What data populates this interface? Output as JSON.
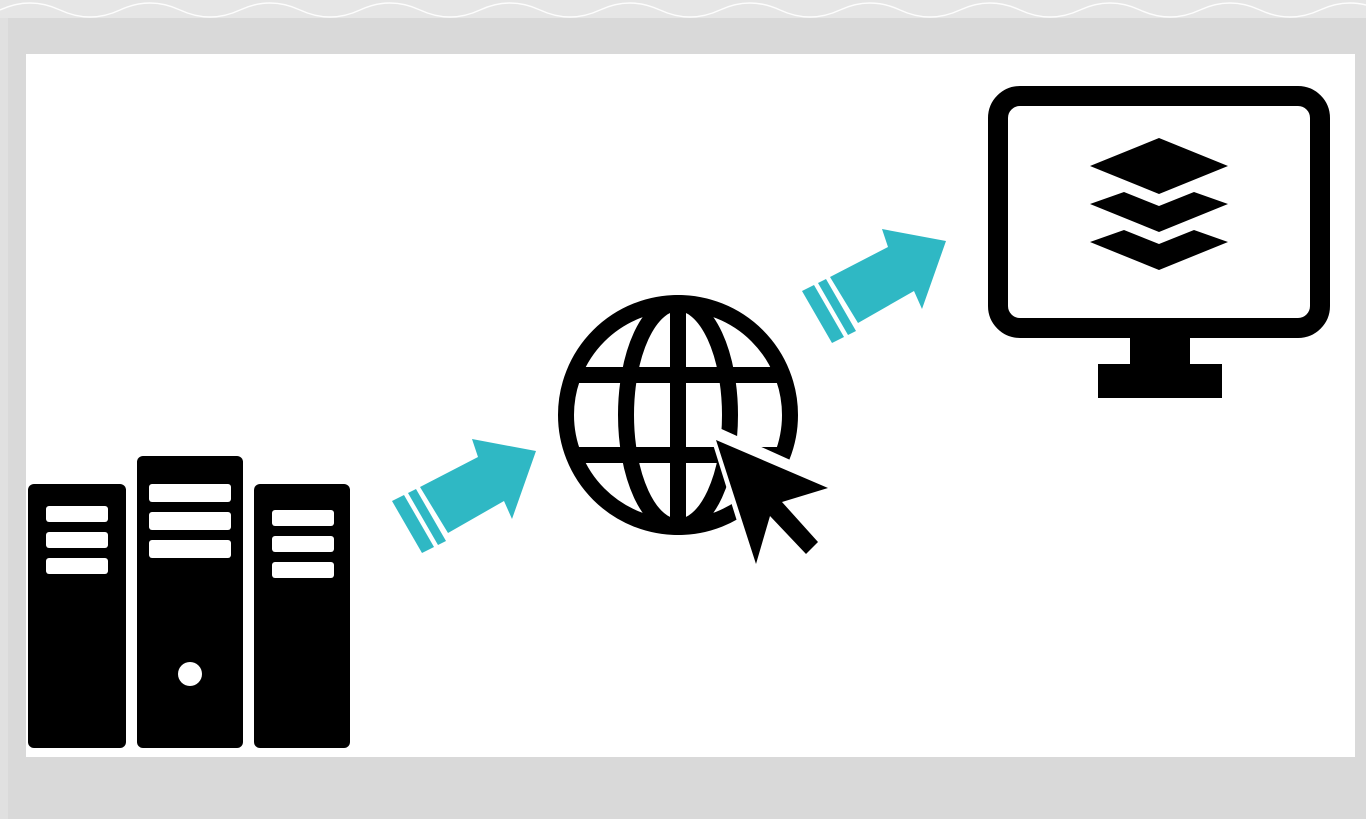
{
  "slide": {
    "description_free": true
  },
  "diagram": {
    "nodes": [
      {
        "id": "server",
        "icon": "server-rack-icon"
      },
      {
        "id": "web",
        "icon": "globe-cursor-icon"
      },
      {
        "id": "client",
        "icon": "monitor-layers-icon"
      }
    ],
    "edges": [
      {
        "from": "server",
        "to": "web",
        "icon": "arrow-icon"
      },
      {
        "from": "web",
        "to": "client",
        "icon": "arrow-icon"
      }
    ]
  },
  "colors": {
    "background": "#d9d9d9",
    "canvas": "#ffffff",
    "icon": "#000000",
    "arrow": "#2fb8c4"
  }
}
